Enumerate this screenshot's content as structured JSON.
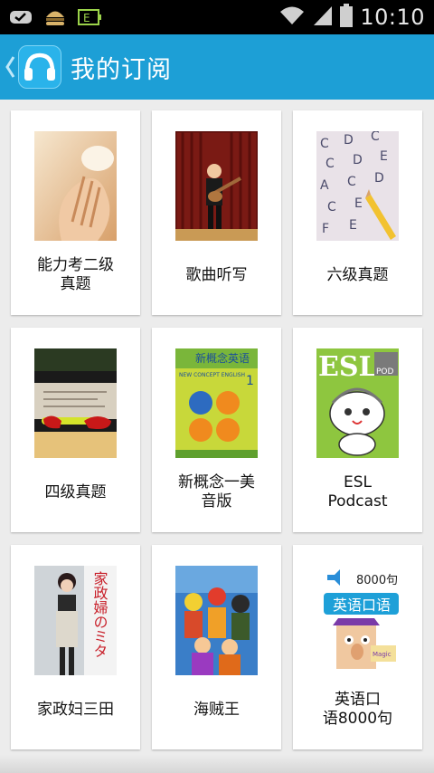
{
  "status_bar": {
    "time": "10:10",
    "icons": [
      "notification-check-icon",
      "burger-food-icon",
      "app-badge-icon",
      "wifi-icon",
      "signal-icon",
      "battery-icon"
    ],
    "badge_text": "E"
  },
  "header": {
    "title": "我的订阅",
    "accent_color": "#1d9fd6",
    "icons": [
      "back-chevron-icon",
      "headphones-icon"
    ]
  },
  "subscriptions": [
    {
      "label": "能力考二级\n真题",
      "thumb": "hands-photo"
    },
    {
      "label": "歌曲听写",
      "thumb": "boy-guitar-stage"
    },
    {
      "label": "六级真题",
      "thumb": "answer-sheet-pencil"
    },
    {
      "label": "四级真题",
      "thumb": "exam-paper-glasses"
    },
    {
      "label": "新概念一美\n音版",
      "thumb": "new-concept-english-book",
      "cover_title": "新概念英语",
      "cover_subtitle": "NEW CONCEPT ENGLISH",
      "cover_number": "1"
    },
    {
      "label": "ESL\nPodcast",
      "thumb": "esl-podcast-cat",
      "cover_title": "ESL",
      "cover_badge": "POD"
    },
    {
      "label": "家政妇三田",
      "thumb": "drama-poster",
      "cover_title": "家政婦のミタ"
    },
    {
      "label": "海贼王",
      "thumb": "one-piece-crew"
    },
    {
      "label": "英语口\n语8000句",
      "thumb": "spoken-english-8000",
      "cover_title": "英语口语",
      "cover_number": "8000句",
      "cover_mini": "Magic"
    }
  ]
}
